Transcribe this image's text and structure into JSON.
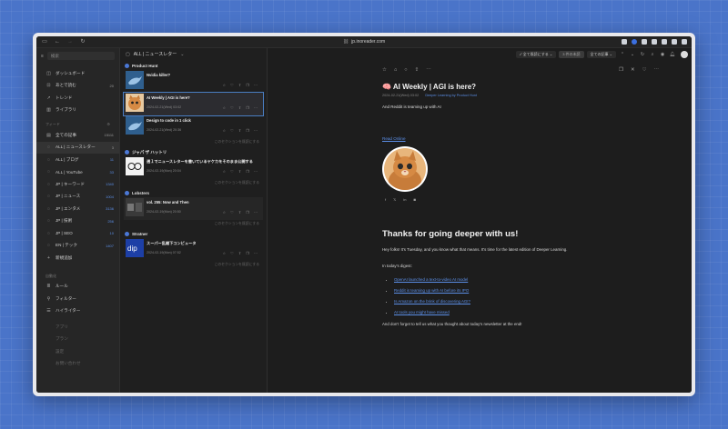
{
  "browser": {
    "url": "jp.inoreader.com"
  },
  "sidebar": {
    "search_placeholder": "検索",
    "items": [
      {
        "icon": "dashboard-icon",
        "label": "ダッシュボード",
        "count": ""
      },
      {
        "icon": "bookmark-icon",
        "label": "あとで読む",
        "count": "20"
      },
      {
        "icon": "trend-icon",
        "label": "トレンド",
        "count": ""
      },
      {
        "icon": "library-icon",
        "label": "ライブラリ",
        "count": ""
      }
    ],
    "feeds_label": "フィード",
    "feeds": [
      {
        "label": "全ての記事",
        "count": "15111",
        "blue": false,
        "active": false
      },
      {
        "label": "ALL | ニュースレター",
        "count": "3",
        "blue": false,
        "active": true
      },
      {
        "label": "ALL | ブログ",
        "count": "11",
        "blue": true,
        "active": false
      },
      {
        "label": "ALL | YouTube",
        "count": "33",
        "blue": true,
        "active": false
      },
      {
        "label": "JP | キーワード",
        "count": "1340",
        "blue": true,
        "active": false
      },
      {
        "label": "JP | ニュース",
        "count": "1004",
        "blue": true,
        "active": false
      },
      {
        "label": "JP | エンタメ",
        "count": "3136",
        "blue": true,
        "active": false
      },
      {
        "label": "JP | 技術",
        "count": "256",
        "blue": true,
        "active": false
      },
      {
        "label": "JP | SEO",
        "count": "10",
        "blue": true,
        "active": false
      },
      {
        "label": "EN | テック",
        "count": "1407",
        "blue": true,
        "active": false
      }
    ],
    "add_label": "新規追加",
    "auto_label": "自動化",
    "auto_items": [
      {
        "icon": "rules-icon",
        "label": "ルール"
      },
      {
        "icon": "filter-icon",
        "label": "フィルター"
      },
      {
        "icon": "highlight-icon",
        "label": "ハイライター"
      }
    ],
    "footer_items": [
      "アプリ",
      "プラン",
      "設定",
      "お問い合わせ"
    ]
  },
  "list": {
    "title": "ALL | ニュースレター",
    "groups": [
      {
        "feed": "Product Hunt",
        "articles": [
          {
            "title": "Nvidia killer?",
            "date": "",
            "thumb": "bird"
          },
          {
            "title": "AI Weekly | AGI is here?",
            "date": "2024-02-21(Wed) 03:02",
            "thumb": "cat",
            "selected": true
          },
          {
            "title": "Design to code in 1 click",
            "date": "2024-02-21(Wed) 20:36",
            "thumb": "bird"
          }
        ],
        "more": "このセクションを既読にする"
      },
      {
        "feed": "ジャパ ザ ハットリ",
        "articles": [
          {
            "title": "週１でニュースレターを書いているヤケカをそのまま公開する",
            "date": "2024-02-19(Mon) 20:04",
            "thumb": "glasses"
          }
        ],
        "more": "このセクションを既読にする"
      },
      {
        "feed": "Lobsters",
        "articles": [
          {
            "title": "vol. 255: Now and Then",
            "date": "2024-02-19(Mon) 20:50",
            "thumb": "photo"
          }
        ],
        "more": "このセクションを既読にする"
      },
      {
        "feed": "Stratner",
        "articles": [
          {
            "title": "スーパー乱雑下コンピュータ",
            "date": "2024-02-19(Mon) 07:52",
            "thumb": "blue"
          }
        ],
        "more": "このセクションを既読にする"
      }
    ]
  },
  "reader": {
    "toolbar": {
      "mark_read": "全て既読にする",
      "unread_count": "3 件の未読",
      "all_articles": "全ての記事"
    },
    "title": "AI Weekly | AGI is here?",
    "date": "2024-02-21(Wed) 03:02",
    "source": "Deeper Learning by Product Hunt",
    "lead": "And Reddit is teaming up with AI",
    "read_online": "Read Online",
    "heading": "Thanks for going deeper with us!",
    "intro": "Hey folks! It's Tuesday, and you know what that means. It's time for the latest edition of Deeper Learning.",
    "digest": "In today's digest:",
    "bullets": [
      "OpenAI launched a text-to-video AI model",
      "Reddit is teaming up with AI before its IPO",
      "Is Amazon on the brink of discovering AGI?",
      "AI tools you might have missed"
    ],
    "outro": "And don't forget to tell us what you thought about today's newsletter at the end!"
  }
}
